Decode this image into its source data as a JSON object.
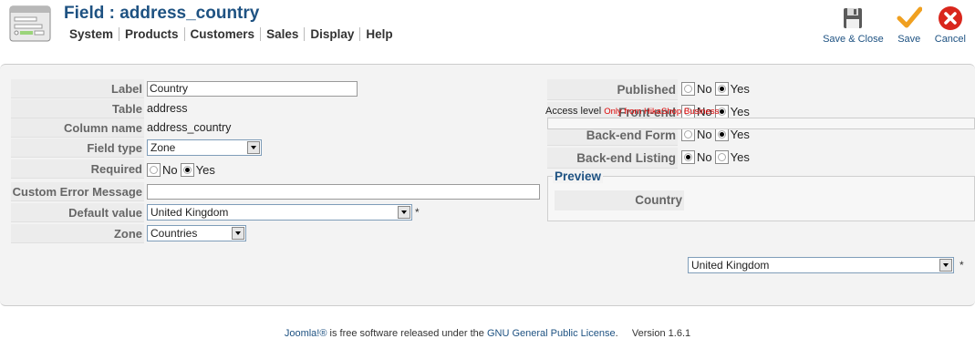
{
  "header": {
    "title": "Field : address_country",
    "menu": [
      "System",
      "Products",
      "Customers",
      "Sales",
      "Display",
      "Help"
    ]
  },
  "toolbar": {
    "save_close_label": "Save & Close",
    "save_label": "Save",
    "cancel_label": "Cancel"
  },
  "form_left": {
    "label_key": "Label",
    "label_value": "Country",
    "table_key": "Table",
    "table_value": "address",
    "column_key": "Column name",
    "column_value": "address_country",
    "fieldtype_key": "Field type",
    "fieldtype_value": "Zone",
    "required_key": "Required",
    "required_no": "No",
    "required_yes": "Yes",
    "required_selected": "Yes",
    "custom_error_key": "Custom Error Message",
    "custom_error_value": "",
    "default_key": "Default value",
    "default_value": "United Kingdom",
    "default_required_mark": "*",
    "zone_key": "Zone",
    "zone_value": "Countries"
  },
  "form_right": {
    "published_key": "Published",
    "frontend_key": "Front-end",
    "backend_form_key": "Back-end Form",
    "backend_listing_key": "Back-end Listing",
    "no": "No",
    "yes": "Yes",
    "published_selected": "Yes",
    "frontend_selected": "Yes",
    "backend_form_selected": "Yes",
    "backend_listing_selected": "No",
    "access_level_label": "Access level",
    "access_level_note": "Only from HikaShop Business"
  },
  "preview": {
    "legend": "Preview",
    "country_key": "Country",
    "country_value": "United Kingdom",
    "required_mark": "*"
  },
  "footer": {
    "joomla_link": "Joomla!®",
    "middle_text": " is free software released under the ",
    "license_link": "GNU General Public License",
    "version_text": ".     Version 1.6.1"
  },
  "colors": {
    "title": "#1e5282",
    "panel": "#f3f3f3",
    "access_note": "#dd0000",
    "save_check": "#f0a020",
    "cancel_red": "#d9261c"
  }
}
